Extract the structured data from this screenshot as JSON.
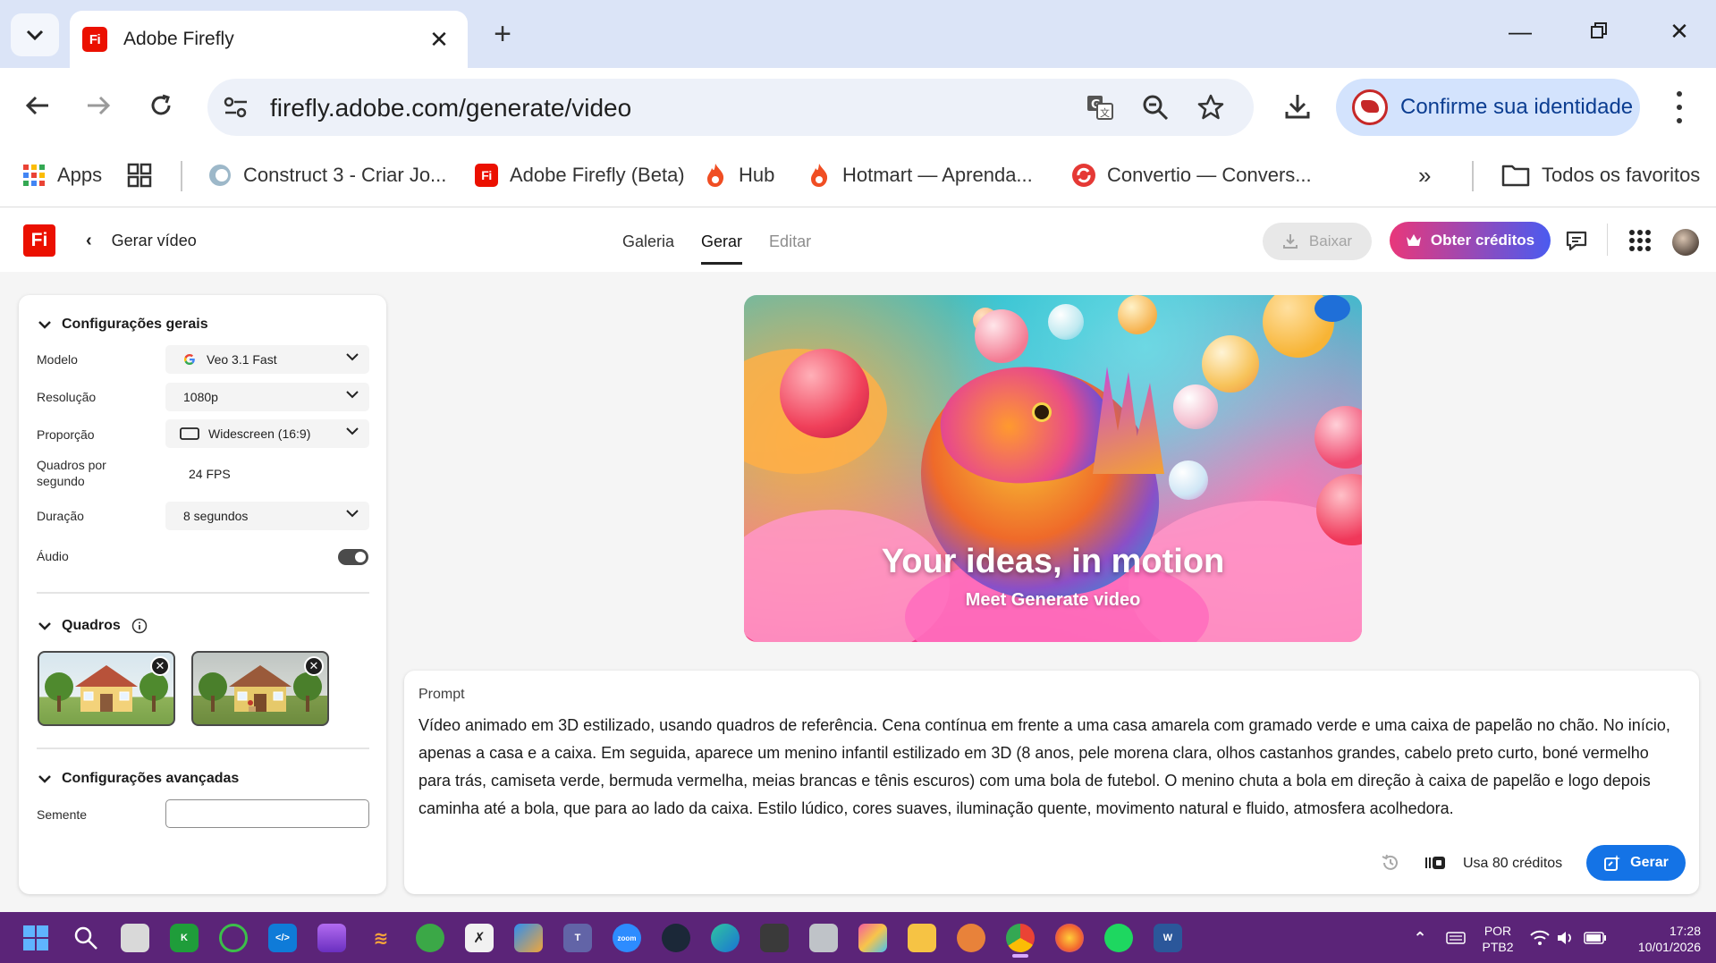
{
  "browser": {
    "tab_title": "Adobe Firefly",
    "url": "firefly.adobe.com/generate/video",
    "identity_label": "Confirme sua identidade",
    "bookmarks": [
      {
        "label": "Apps"
      },
      {
        "label": "Construct 3 - Criar Jo..."
      },
      {
        "label": "Adobe Firefly (Beta)"
      },
      {
        "label": "Hub"
      },
      {
        "label": "Hotmart — Aprenda..."
      },
      {
        "label": "Convertio — Convers..."
      }
    ],
    "all_bookmarks_label": "Todos os favoritos"
  },
  "app": {
    "back_label": "Gerar vídeo",
    "nav": [
      {
        "label": "Galeria",
        "state": "normal"
      },
      {
        "label": "Gerar",
        "state": "active"
      },
      {
        "label": "Editar",
        "state": "disabled"
      }
    ],
    "download_label": "Baixar",
    "credits_label": "Obter créditos"
  },
  "settings": {
    "general_title": "Configurações gerais",
    "model_label": "Modelo",
    "model_value": "Veo 3.1 Fast",
    "resolution_label": "Resolução",
    "resolution_value": "1080p",
    "aspect_label": "Proporção",
    "aspect_value": "Widescreen (16:9)",
    "fps_label": "Quadros por segundo",
    "fps_value": "24 FPS",
    "duration_label": "Duração",
    "duration_value": "8 segundos",
    "audio_label": "Áudio",
    "audio_enabled": true,
    "frames_title": "Quadros",
    "advanced_title": "Configurações avançadas",
    "seed_label": "Semente",
    "seed_value": ""
  },
  "hero": {
    "title": "Your ideas, in motion",
    "subtitle": "Meet Generate video"
  },
  "prompt": {
    "label": "Prompt",
    "text": "Vídeo animado em 3D estilizado, usando quadros de referência. Cena contínua em frente a uma casa amarela com gramado verde e uma caixa de papelão no chão. No início, apenas a casa e a caixa. Em seguida, aparece um menino infantil estilizado em 3D (8 anos, pele morena clara, olhos castanhos grandes, cabelo preto curto, boné vermelho para trás, camiseta verde, bermuda vermelha, meias brancas e tênis escuros) com uma bola de futebol. O menino chuta a bola em direção à caixa de papelão e logo depois caminha até a bola, que para ao lado da caixa. Estilo lúdico, cores suaves, iluminação quente, movimento natural e fluido, atmosfera acolhedora.",
    "credits_text": "Usa 80 créditos",
    "generate_label": "Gerar"
  },
  "taskbar": {
    "lang_line1": "POR",
    "lang_line2": "PTB2",
    "time": "17:28",
    "date": "10/01/2026"
  },
  "colors": {
    "accent_blue": "#1473e6",
    "adobe_red": "#eb1000",
    "taskbar": "#5b2478"
  }
}
